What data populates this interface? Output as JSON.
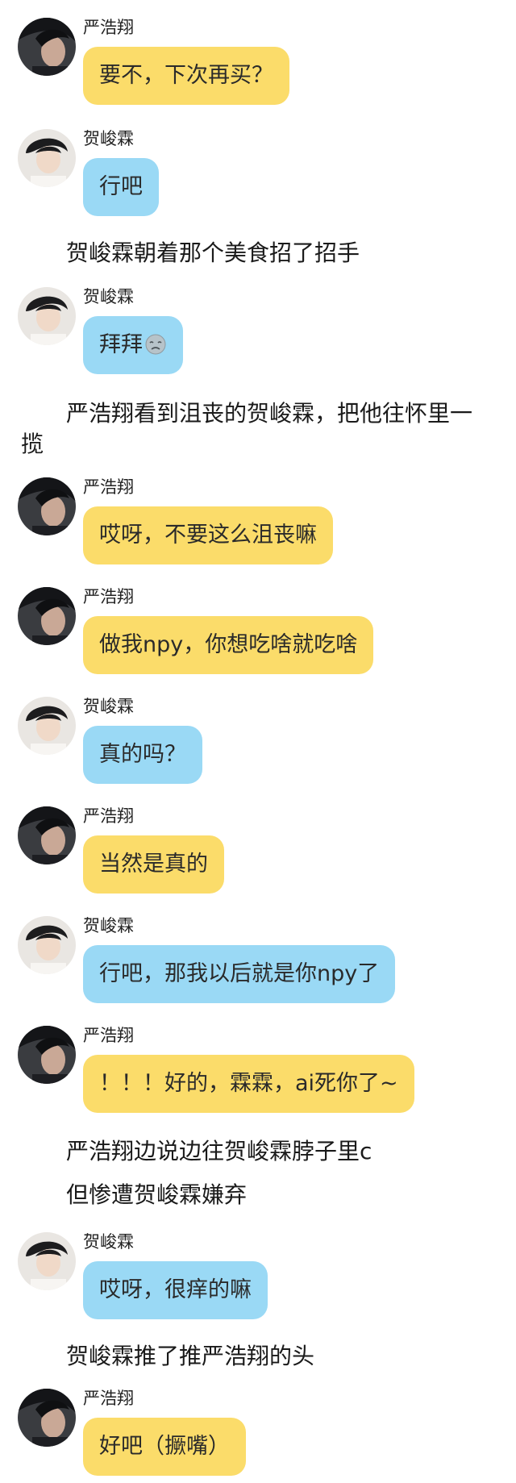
{
  "colors": {
    "yellow_bubble": "#fbdc6a",
    "blue_bubble": "#9ad9f5",
    "background": "#ffffff"
  },
  "icons": {
    "yan_avatar": "yan-avatar-icon",
    "he_avatar": "he-avatar-icon",
    "sad_emoji": "sad-face-icon"
  },
  "messages": [
    {
      "sender": "严浩翔",
      "text": "要不，下次再买？"
    },
    {
      "sender": "贺峻霖",
      "text": "行吧"
    },
    {
      "narration": "贺峻霖朝着那个美食招了招手"
    },
    {
      "sender": "贺峻霖",
      "text": "拜拜"
    },
    {
      "narration_line1": "严浩翔看到沮丧的贺峻霖，把他往怀里一",
      "narration_line2": "揽"
    },
    {
      "sender": "严浩翔",
      "text": "哎呀，不要这么沮丧嘛"
    },
    {
      "sender": "严浩翔",
      "text": "做我npy，你想吃啥就吃啥"
    },
    {
      "sender": "贺峻霖",
      "text": "真的吗？"
    },
    {
      "sender": "严浩翔",
      "text": "当然是真的"
    },
    {
      "sender": "贺峻霖",
      "text": "行吧，那我以后就是你npy了"
    },
    {
      "sender": "严浩翔",
      "text": "！！！好的，霖霖，ai死你了~"
    },
    {
      "narration": "严浩翔边说边往贺峻霖脖子里c"
    },
    {
      "narration": "但惨遭贺峻霖嫌弃"
    },
    {
      "sender": "贺峻霖",
      "text": "哎呀，很痒的嘛"
    },
    {
      "narration": "贺峻霖推了推严浩翔的头"
    },
    {
      "sender": "严浩翔",
      "text": "好吧（撅嘴）"
    }
  ]
}
